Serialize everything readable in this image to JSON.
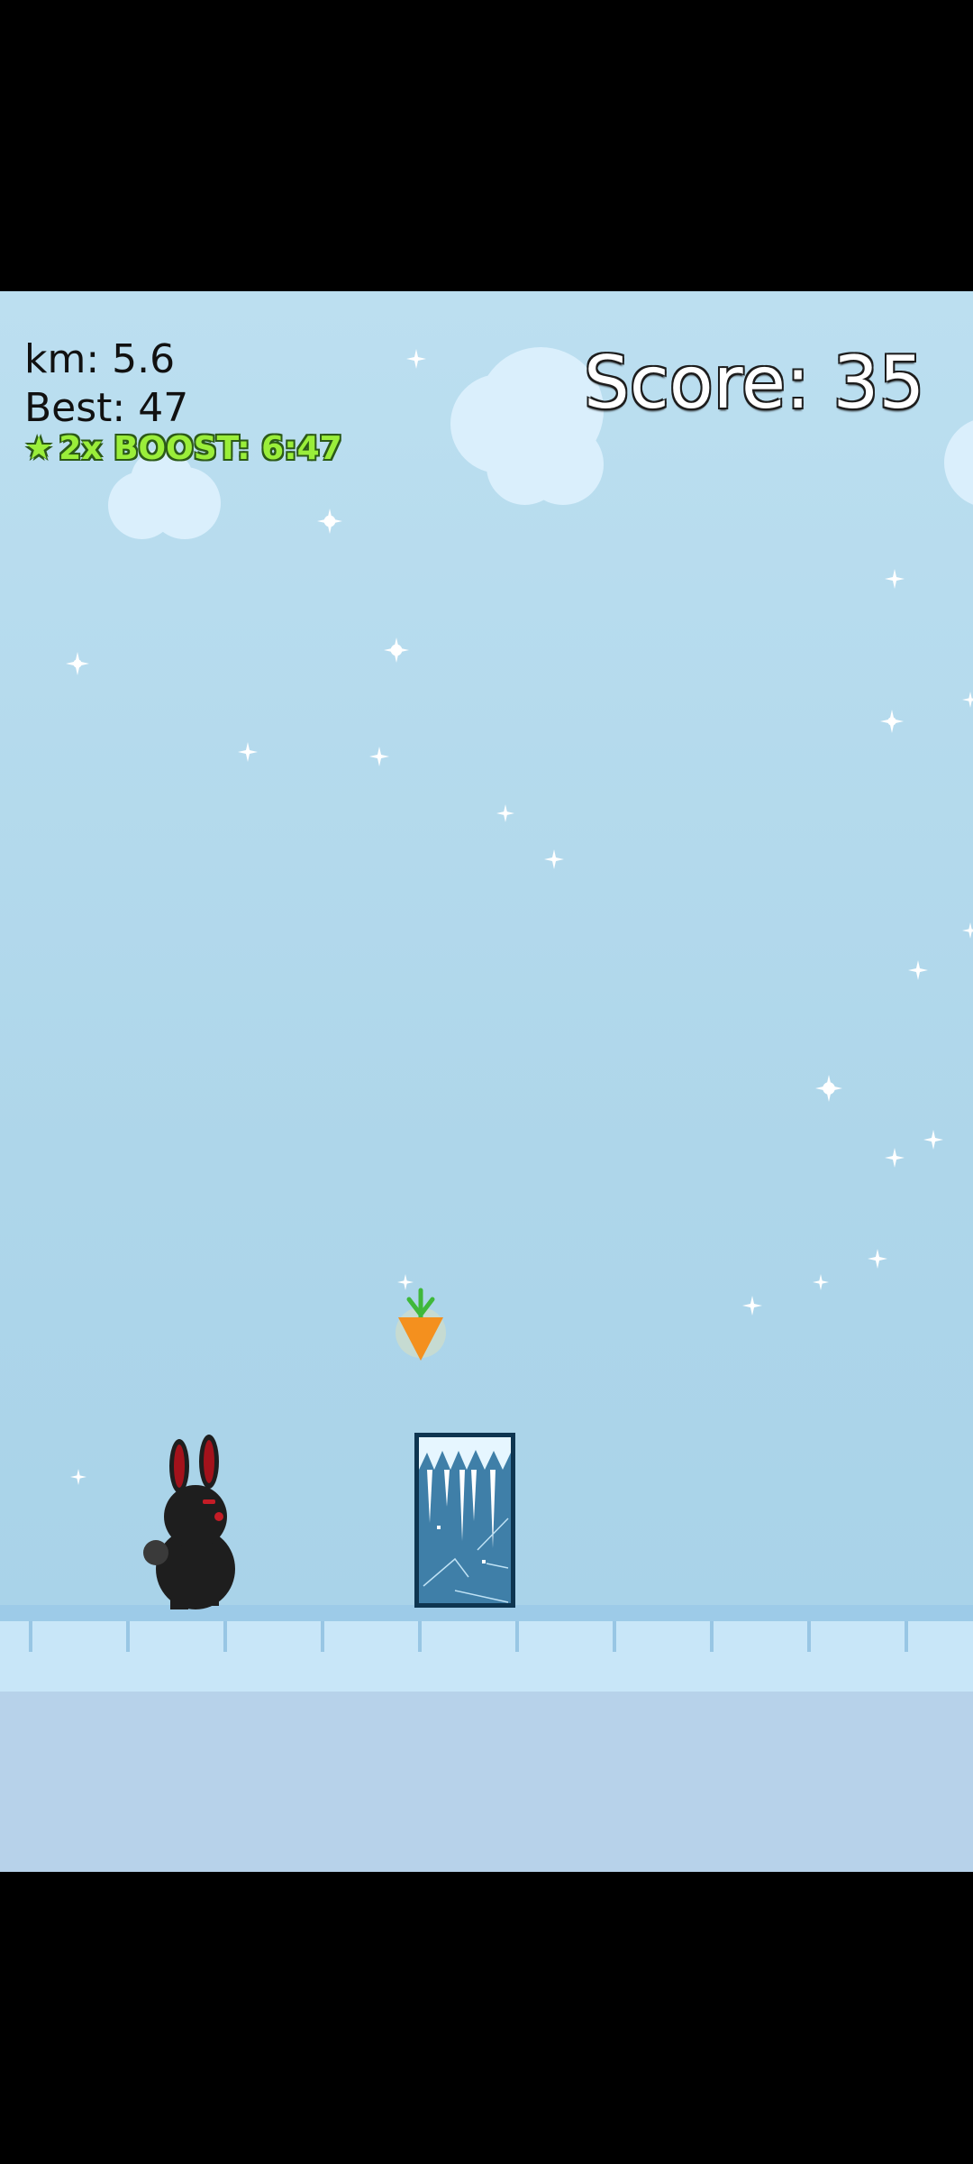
{
  "hud": {
    "distance_text": "km: 5.6",
    "best_text": "Best: 47",
    "boost_icon": "star",
    "boost_text": "2x BOOST: 6:47",
    "score_text": "Score: 35"
  },
  "colors": {
    "sky": "#aed6ea",
    "boost_text": "#9aee3a",
    "carrot": "#f4901e",
    "carrot_leaves": "#3fb83a",
    "bunny": "#1e1e1e",
    "bunny_ears": "#a3121b"
  },
  "game": {
    "player": "black-bunny",
    "pickup": "carrot",
    "obstacle": "ice-block-with-icicles"
  }
}
